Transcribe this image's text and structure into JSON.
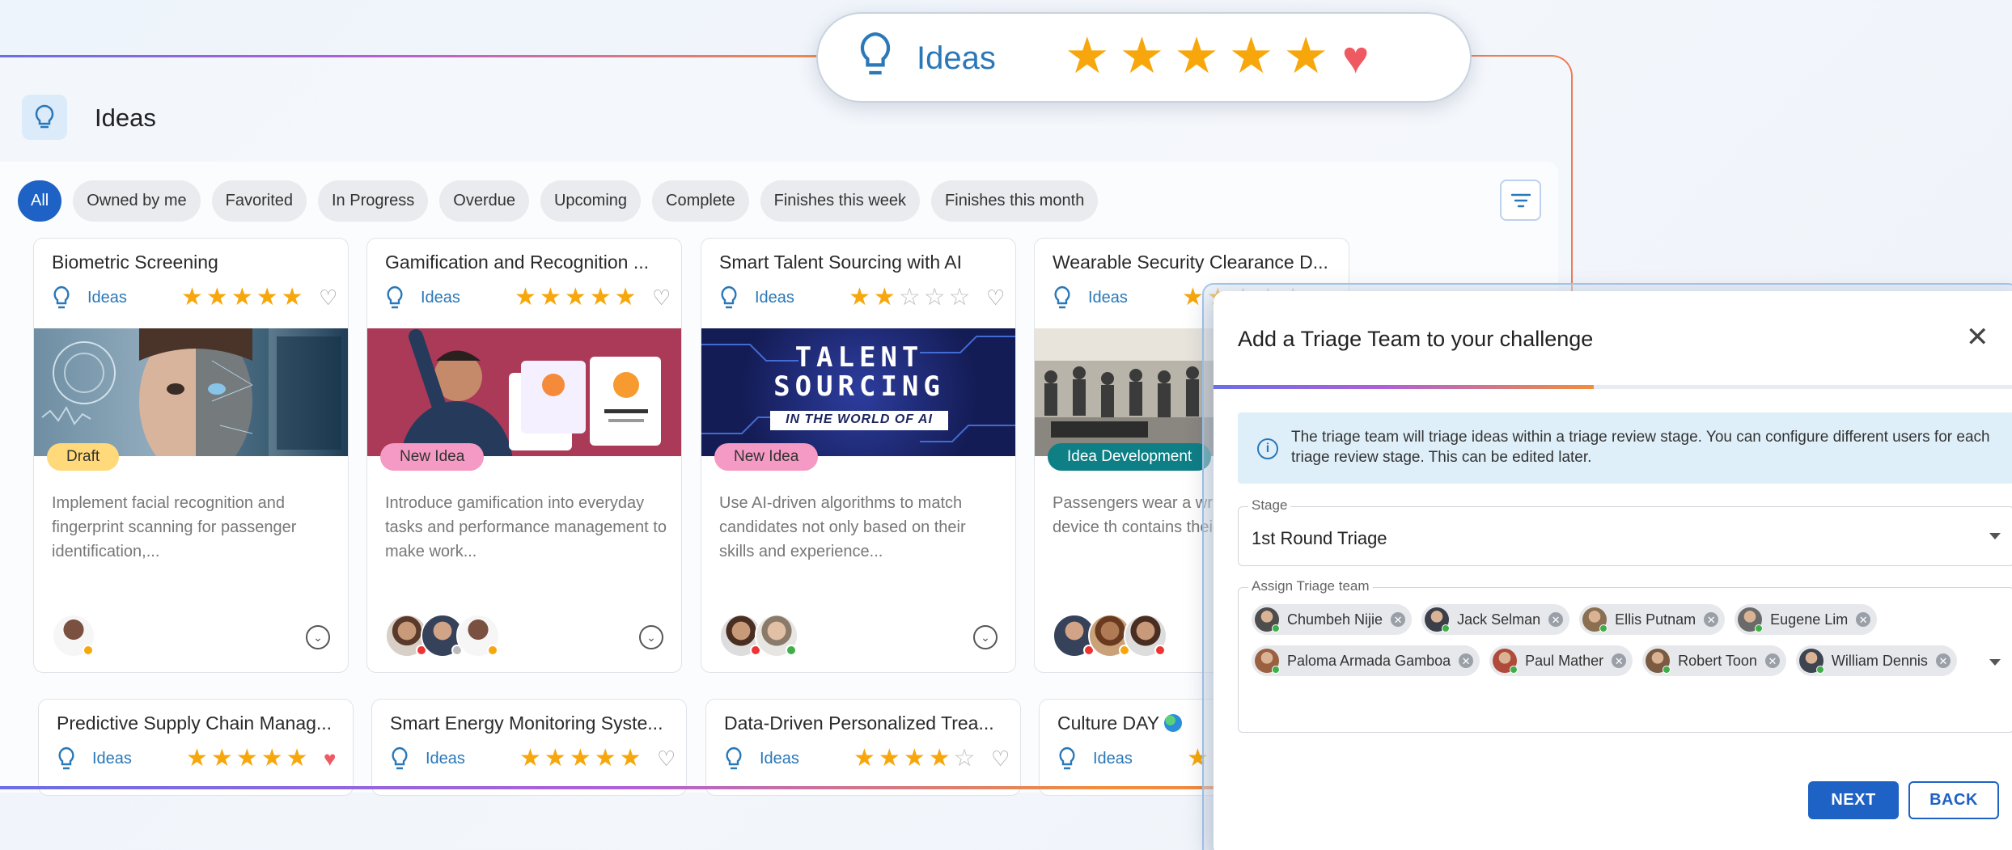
{
  "header": {
    "title": "Ideas"
  },
  "filters": [
    "All",
    "Owned by me",
    "Favorited",
    "In Progress",
    "Overdue",
    "Upcoming",
    "Complete",
    "Finishes this week",
    "Finishes this month"
  ],
  "rating_pill": {
    "category": "Ideas",
    "rating": 5,
    "favorited": true
  },
  "cards": [
    {
      "title": "Biometric Screening",
      "category": "Ideas",
      "rating": 5,
      "favorited": false,
      "status": "Draft",
      "image_text": "",
      "description": "Implement facial recognition and fingerprint scanning for passenger identification,..."
    },
    {
      "title": "Gamification and Recognition ...",
      "category": "Ideas",
      "rating": 5,
      "favorited": false,
      "status": "New Idea",
      "image_text": "",
      "description": "Introduce gamification into everyday tasks and performance management to make work..."
    },
    {
      "title": "Smart Talent Sourcing with AI",
      "category": "Ideas",
      "rating": 2,
      "favorited": false,
      "status": "New Idea",
      "image_text": "TALENT SOURCING",
      "image_subtext": "IN THE WORLD OF AI",
      "description": "Use AI-driven algorithms to match candidates not only based on their skills and experience..."
    },
    {
      "title": "Wearable Security Clearance D...",
      "category": "Ideas",
      "rating": 2,
      "favorited": false,
      "status": "Idea Development",
      "image_text": "",
      "description": "Passengers wear a wr carry a small device th contains their pre-scr"
    }
  ],
  "cards_row2": [
    {
      "title": "Predictive Supply Chain Manag...",
      "category": "Ideas",
      "rating": 5,
      "favorited": true
    },
    {
      "title": "Smart Energy Monitoring Syste...",
      "category": "Ideas",
      "rating": 5,
      "favorited": false
    },
    {
      "title": "Data-Driven Personalized Trea...",
      "category": "Ideas",
      "rating": 4,
      "favorited": false
    },
    {
      "title": "Culture DAY",
      "category": "Ideas",
      "rating": 2,
      "favorited": false
    }
  ],
  "modal": {
    "title": "Add a Triage Team to your challenge",
    "progress": 0.47,
    "info": "The triage team will triage ideas within a triage review stage. You can configure different users for each triage review stage.  This can be edited later.",
    "stage_label": "Stage",
    "stage_value": "1st Round Triage",
    "team_label": "Assign Triage team",
    "team": [
      "Chumbeh Nijie",
      "Jack Selman",
      "Ellis Putnam",
      "Eugene Lim",
      "Paloma Armada Gamboa",
      "Paul Mather",
      "Robert Toon",
      "William Dennis"
    ],
    "next_label": "NEXT",
    "back_label": "BACK"
  },
  "colors": {
    "accent": "#1d62c4",
    "star": "#f7a70b",
    "heart": "#ef5a62",
    "link": "#2a78b8"
  }
}
